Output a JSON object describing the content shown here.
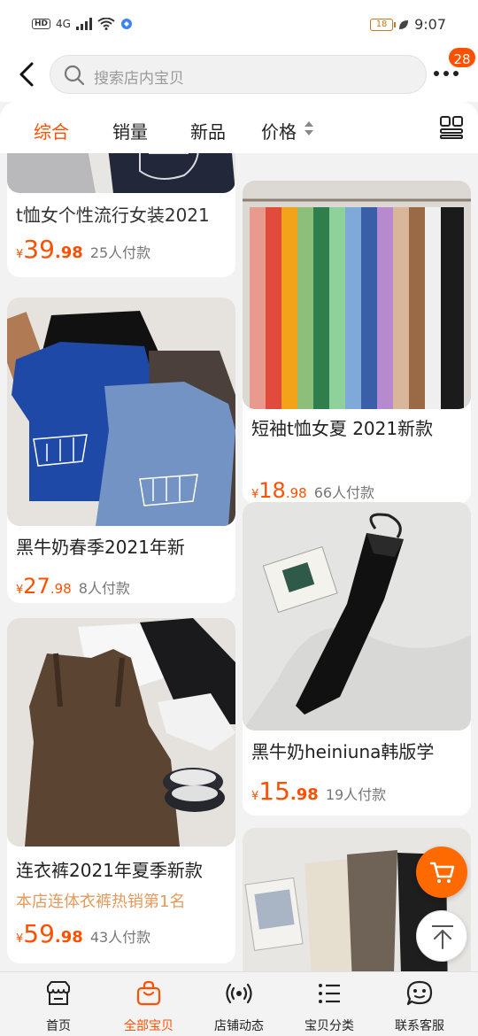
{
  "status": {
    "network": "4G",
    "battery": "18",
    "time": "9:07"
  },
  "search": {
    "placeholder": "搜索店内宝贝"
  },
  "header": {
    "badge": "28"
  },
  "tabs": [
    {
      "label": "综合",
      "active": true
    },
    {
      "label": "销量"
    },
    {
      "label": "新品"
    },
    {
      "label": "价格"
    }
  ],
  "products": [
    {
      "title": "t恤女个性流行女装2021",
      "price_int": "39",
      "price_dec": ".98",
      "sold": "25人付款"
    },
    {
      "title": "短袖t恤女夏 2021新款",
      "price_int": "18",
      "price_dec": ".98",
      "sold": "66人付款"
    },
    {
      "title": "黑牛奶春季2021年新",
      "price_int": "27",
      "price_dec": ".98",
      "sold": "8人付款"
    },
    {
      "title": "黑牛奶heiniuna韩版学",
      "price_int": "15",
      "price_dec": ".98",
      "sold": "19人付款"
    },
    {
      "title": "连衣裤2021年夏季新款",
      "subtitle": "本店连体衣裤热销第1名",
      "price_int": "59",
      "price_dec": ".98",
      "sold": "43人付款"
    }
  ],
  "currency": "¥",
  "bottom_nav": [
    {
      "label": "首页"
    },
    {
      "label": "全部宝贝",
      "active": true
    },
    {
      "label": "店铺动态"
    },
    {
      "label": "宝贝分类"
    },
    {
      "label": "联系客服"
    }
  ],
  "colors": {
    "accent": "#ff5000",
    "price": "#ff5000",
    "subtitle": "#e49a5c"
  }
}
